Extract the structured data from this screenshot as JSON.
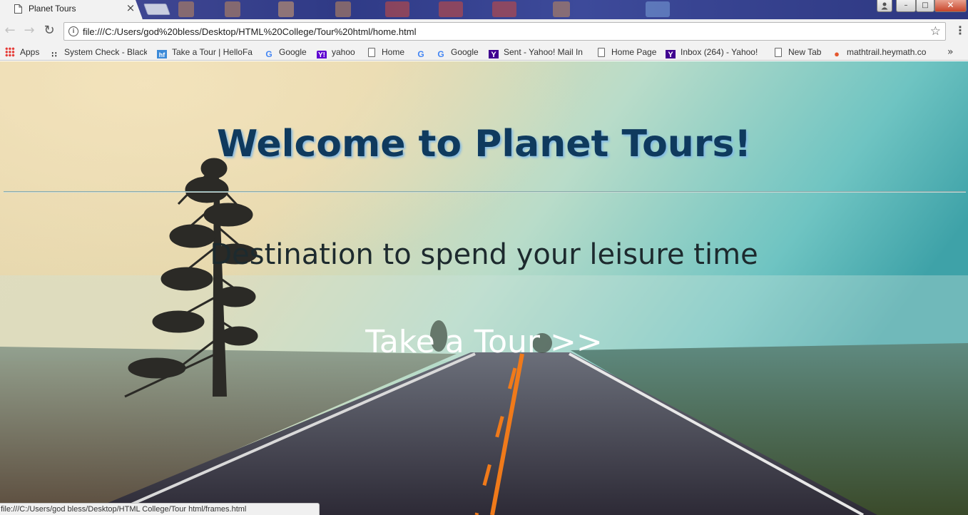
{
  "browser": {
    "tab": {
      "title": "Planet Tours",
      "close_glyph": "×"
    },
    "window_controls": {
      "minimize": "–",
      "maximize": "□",
      "close": "✕"
    },
    "address_bar": {
      "url": "file:///C:/Users/god%20bless/Desktop/HTML%20College/Tour%20html/home.html"
    },
    "bookmarks": [
      {
        "label": "Apps",
        "icon": "apps-grid-icon"
      },
      {
        "label": "System Check - Black",
        "icon": "blackboard-icon"
      },
      {
        "label": "Take a Tour | HelloFa",
        "icon": "hellofax-icon"
      },
      {
        "label": "Google",
        "icon": "google-icon"
      },
      {
        "label": "yahoo",
        "icon": "yahoo-icon"
      },
      {
        "label": "Home",
        "icon": "page-icon"
      },
      {
        "label": "",
        "icon": "google-icon"
      },
      {
        "label": "Google",
        "icon": "google-icon"
      },
      {
        "label": "Sent - Yahoo! Mail In",
        "icon": "yahoo-mail-icon"
      },
      {
        "label": "Home Page",
        "icon": "page-icon"
      },
      {
        "label": "Inbox (264) - Yahoo!",
        "icon": "yahoo-mail-icon"
      },
      {
        "label": "New Tab",
        "icon": "page-icon"
      },
      {
        "label": "mathtrail.heymath.co",
        "icon": "map-pin-icon"
      }
    ],
    "bookmarks_more": "»",
    "status_url": "file:///C:/Users/god bless/Desktop/HTML College/Tour html/frames.html"
  },
  "page": {
    "heading": "Welcome to Planet Tours!",
    "tagline": "Destination to spend your leisure time",
    "cta_link": "Take a Tour >>",
    "colors": {
      "heading": "#0f3a5e",
      "heading_shadow": "#7fb7e6",
      "tagline": "#1d2a2e",
      "cta": "#ffffff"
    }
  }
}
